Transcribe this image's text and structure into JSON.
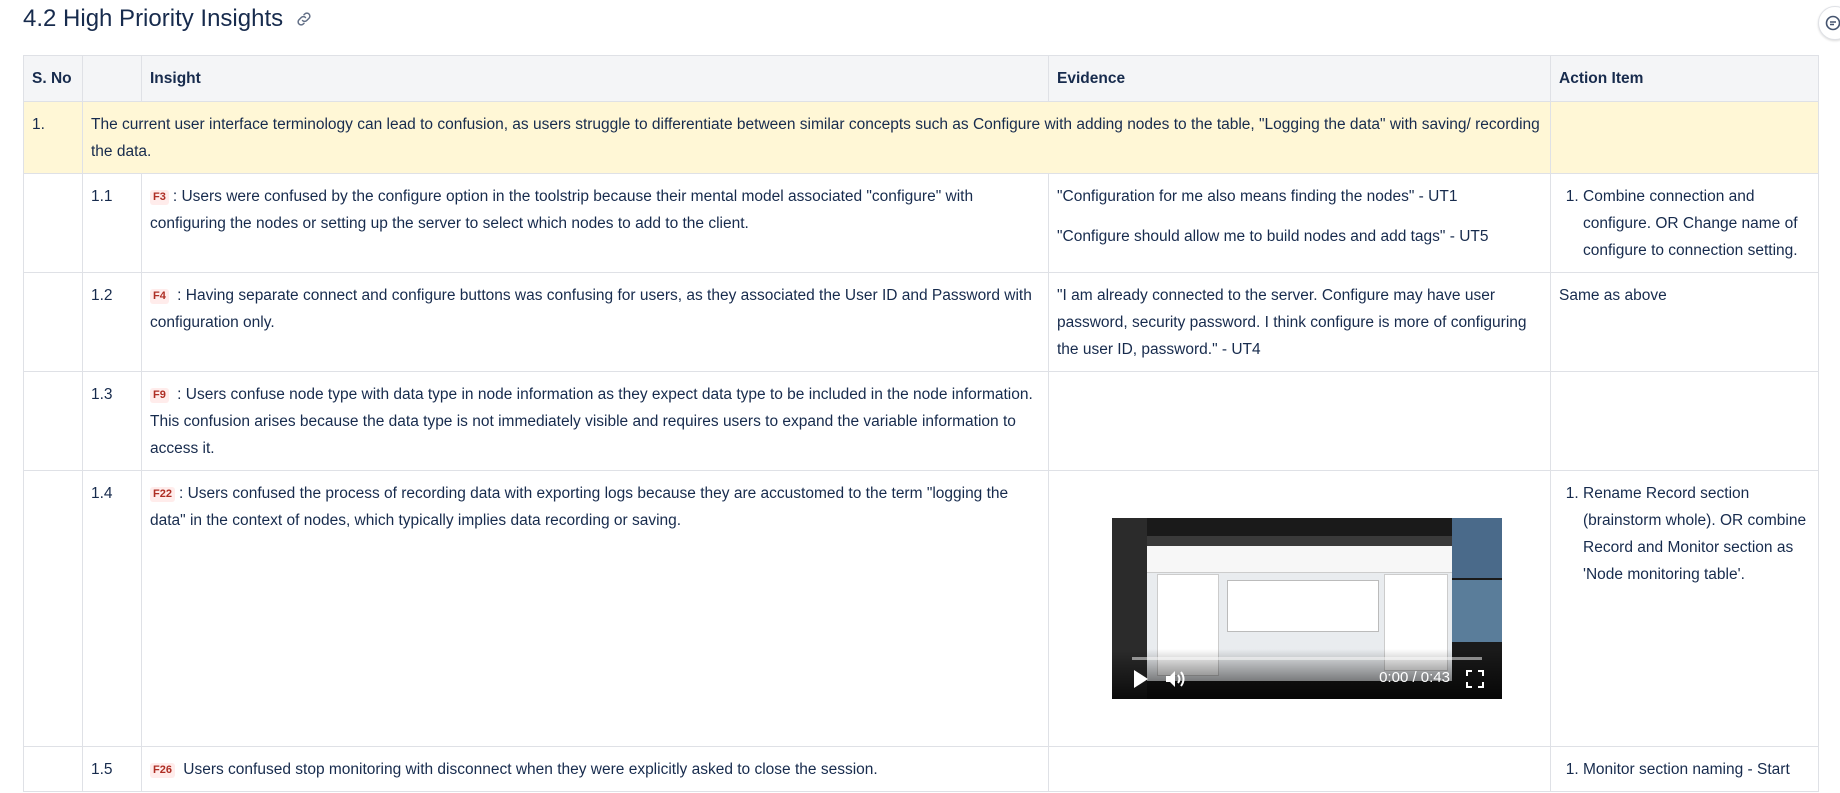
{
  "section": {
    "title": "4.2 High Priority Insights"
  },
  "table": {
    "headers": {
      "sno": "S. No",
      "sub": "",
      "insight": "Insight",
      "evidence": "Evidence",
      "action": "Action Item"
    },
    "main_row": {
      "number": "1.",
      "text": "The current user interface terminology can lead to confusion, as users struggle to differentiate between similar concepts such as Configure with adding nodes to the table, \"Logging the data\" with saving/ recording the data."
    },
    "rows": [
      {
        "id": "1.1",
        "tag": "F3",
        "insight": ":  Users were confused by the configure option in the toolstrip because their mental model associated \"configure\" with configuring the nodes or setting up the server to select which nodes to add to the client.",
        "evidence": [
          "\"Configuration for me also means finding the nodes\" - UT1",
          "\"Configure should allow me to build nodes and add tags\" - UT5"
        ],
        "action": "Combine connection and configure. OR Change name of configure to connection setting."
      },
      {
        "id": "1.2",
        "tag": "F4",
        "insight": " : Having separate connect and configure buttons was confusing for users, as they associated the User ID and Password with configuration only.",
        "evidence": "\"I am already connected to the server. Configure may have user password, security password. I think configure is more of configuring the user ID, password.\" - UT4",
        "action": "Same as above"
      },
      {
        "id": "1.3",
        "tag": "F9",
        "insight": " : Users confuse node type with data type in node information as they expect data type to be included in the node information. This confusion arises because the data type is not immediately visible and requires users to expand the variable information to access it."
      },
      {
        "id": "1.4",
        "tag": "F22",
        "insight": ": Users confused the process of recording data with exporting logs because they are accustomed to the term \"logging the data\" in the context of nodes, which typically implies data recording or saving.",
        "video_time": "0:00 / 0:43",
        "action": "Rename Record section (brainstorm whole). OR combine Record and Monitor section as 'Node monitoring table'."
      },
      {
        "id": "1.5",
        "tag": "F26",
        "insight": "  Users confused stop monitoring with disconnect when they were explicitly asked to close the session.",
        "action": "Monitor section naming - Start"
      }
    ]
  }
}
